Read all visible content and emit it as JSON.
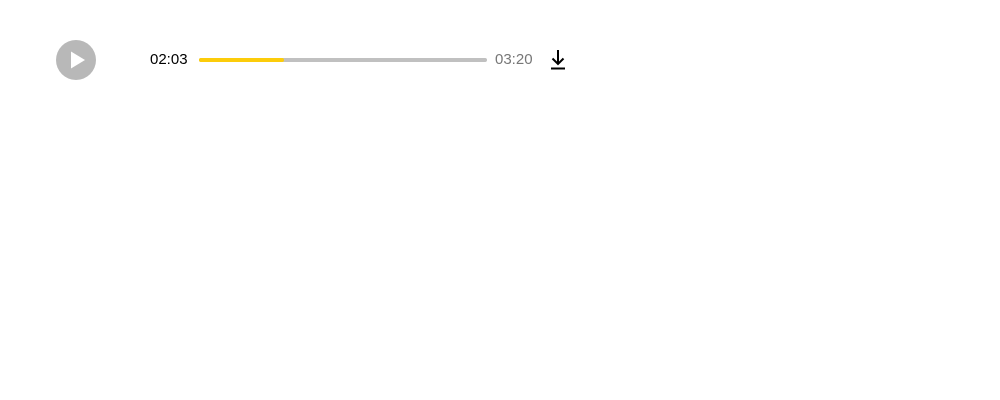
{
  "player": {
    "current_time": "02:03",
    "total_time": "03:20",
    "progress_fraction": 0.295,
    "icons": {
      "play": "play-icon",
      "download": "download-icon"
    },
    "colors": {
      "play_button_bg": "#b8b8b8",
      "progress_fill": "#fccc0a",
      "progress_track": "#c0c0c0",
      "current_time_text": "#000000",
      "total_time_text": "#777777"
    }
  }
}
